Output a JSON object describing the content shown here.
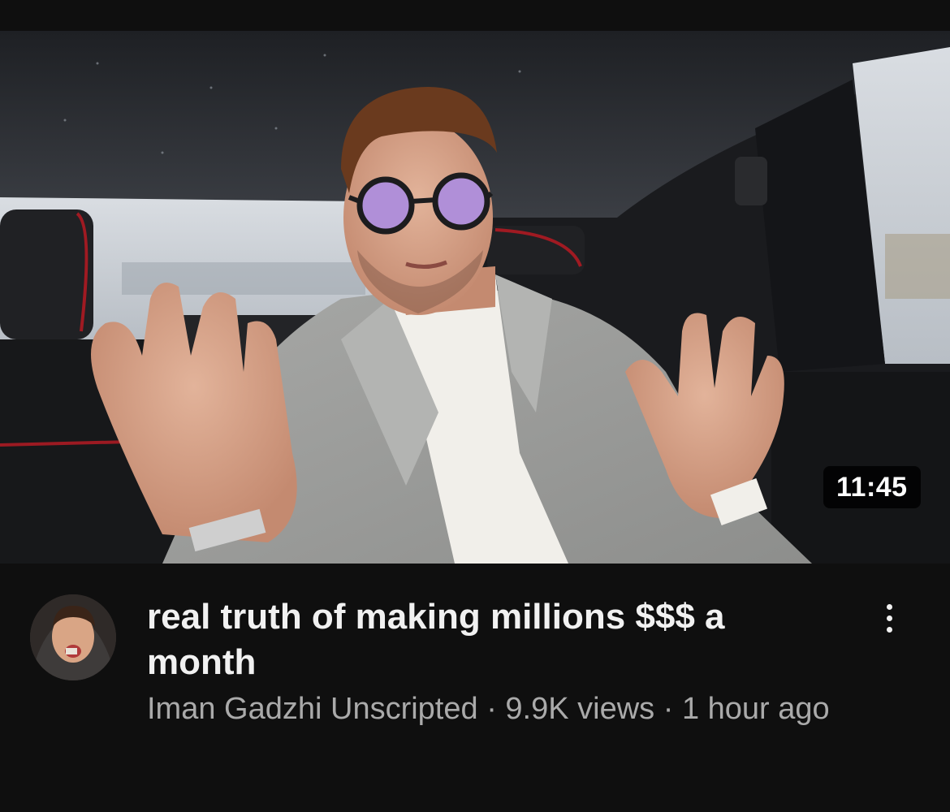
{
  "video": {
    "duration": "11:45",
    "title": "real truth of making millions $$$ a month",
    "channel": "Iman Gadzhi Unscripted",
    "separator": " · ",
    "views": "9.9K views",
    "age": "1 hour ago"
  },
  "icons": {
    "more": "more-vert-icon",
    "avatar": "channel-avatar"
  },
  "colors": {
    "background": "#0f0f0f",
    "title": "#f1f1f1",
    "meta_text": "#aaaaaa",
    "duration_badge_bg": "#000000"
  }
}
